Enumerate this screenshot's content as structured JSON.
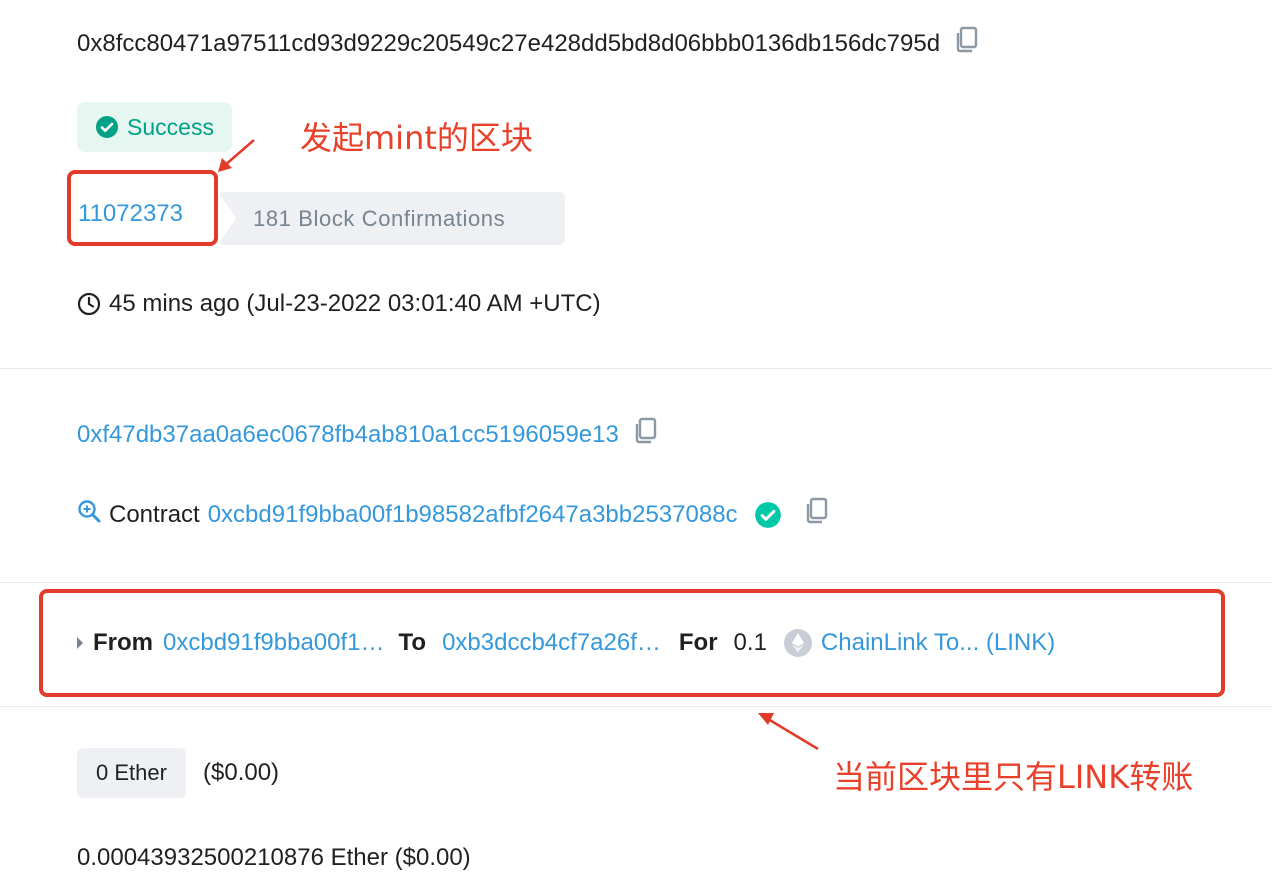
{
  "transaction": {
    "hash": "0x8fcc80471a97511cd93d9229c20549c27e428dd5bd8d06bbb0136db156dc795d",
    "status": "Success",
    "block_number": "11072373",
    "block_confirmations": "181 Block Confirmations",
    "timestamp": "45 mins ago (Jul-23-2022 03:01:40 AM +UTC)",
    "from": "0xf47db37aa0a6ec0678fb4ab810a1cc5196059e13",
    "to_prefix": "Contract",
    "to_contract": "0xcbd91f9bba00f1b98582afbf2647a3bb2537088c",
    "token_transfer": {
      "from_label": "From",
      "from_addr": "0xcbd91f9bba00f1…",
      "to_label": "To",
      "to_addr": "0xb3dccb4cf7a26f…",
      "for_label": "For",
      "amount": "0.1",
      "token": "ChainLink To... (LINK)"
    },
    "value": "0 Ether",
    "value_usd": "($0.00)",
    "fee": "0.00043932500210876 Ether ($0.00)"
  },
  "annotations": {
    "block_note": "发起mint的区块",
    "transfer_note": "当前区块里只有LINK转账"
  },
  "colors": {
    "link": "#3498db",
    "success": "#00a186",
    "annotation": "#e8402a"
  }
}
